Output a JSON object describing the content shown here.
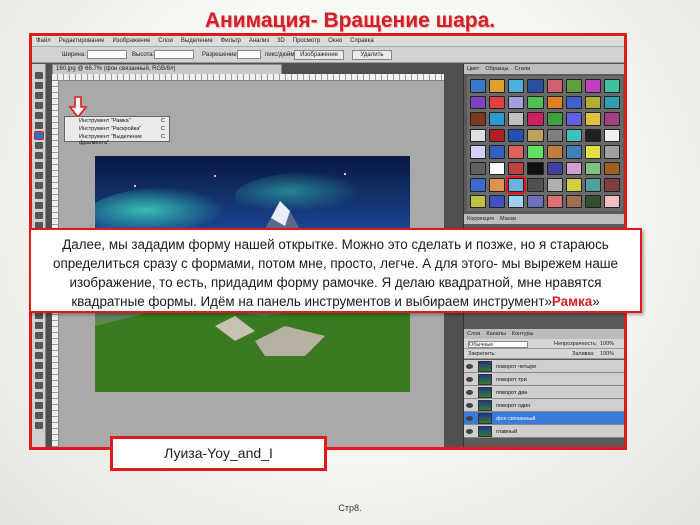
{
  "slide": {
    "title": "Анимация- Вращение шара.",
    "page_label": "Стр8."
  },
  "photoshop": {
    "menu": [
      "Файл",
      "Редактирование",
      "Изображение",
      "Слои",
      "Выделение",
      "Фильтр",
      "Анализ",
      "3D",
      "Просмотр",
      "Окно",
      "Справка"
    ],
    "options": {
      "width_label": "Ширина:",
      "height_label": "Высота:",
      "resolution_label": "Разрешение:",
      "resolution_unit": "пикс/дюйм",
      "image_button": "Изображение",
      "delete_button": "Удалить"
    },
    "document_tab": "160.jpg @ 66.7% (фон связанный, RGB/8#)",
    "tool_flyout": [
      {
        "label": "Инструмент \"Рамка\"",
        "key": "C"
      },
      {
        "label": "Инструмент \"Раскройка\"",
        "key": "C"
      },
      {
        "label": "Инструмент \"Выделение фрагмента\"",
        "key": "C"
      }
    ],
    "panel_tabs": [
      "Цвет",
      "Образцы",
      "Стили"
    ],
    "panel_tabs2": [
      "Коррекция",
      "Маски"
    ],
    "layers_tabs": [
      "Слои",
      "Каналы",
      "Контуры"
    ],
    "blend_mode": "Обычные",
    "opacity_label": "Непрозрачность:",
    "opacity_value": "100%",
    "lock_label": "Закрепить:",
    "fill_label": "Заливка:",
    "fill_value": "100%",
    "layers": [
      {
        "name": "поворот четыре",
        "selected": false
      },
      {
        "name": "поворот три",
        "selected": false
      },
      {
        "name": "поворот два",
        "selected": false
      },
      {
        "name": "поворот один",
        "selected": false
      },
      {
        "name": "фон связанный",
        "selected": true
      },
      {
        "name": "главный",
        "selected": false
      }
    ],
    "swatch_colors": [
      "#3a7ac8",
      "#e0a030",
      "#4ab0e0",
      "#2a50a0",
      "#d06070",
      "#60a040",
      "#c040c0",
      "#40c0a0",
      "#8040c0",
      "#e04040",
      "#a0a0e0",
      "#50c050",
      "#e08020",
      "#4060d0",
      "#b0b030",
      "#30a0b0",
      "#7a3a20",
      "#2a9ad0",
      "#c0c0c0",
      "#d02060",
      "#40a040",
      "#6060e0",
      "#e0c040",
      "#a04080",
      "#e0e0e0",
      "#b02020",
      "#2050b0",
      "#c0a060",
      "#808080",
      "#40c0c0",
      "#202020",
      "#f0f0f0",
      "#d0d0ff",
      "#3060c0",
      "#e06060",
      "#60e060",
      "#c08040",
      "#4080c0",
      "#e0e040",
      "#a0a0a0",
      "#606060",
      "#ffffff",
      "#c04040",
      "#101010",
      "#4040a0",
      "#d0a0d0",
      "#80c080",
      "#a06020",
      "#3a6ad0",
      "#e09050",
      "#70b0e0",
      "#505050",
      "#b0b0b0",
      "#d0d040",
      "#50a0a0",
      "#804040",
      "#c0c040",
      "#4050c0",
      "#a0d0f0",
      "#7070c0",
      "#e07070",
      "#a07050",
      "#305030",
      "#f0c0c0"
    ]
  },
  "instruction": {
    "text": "Далее, мы зададим форму нашей открытке. Можно это сделать и позже, но я стараюсь определиться сразу с формами, потом мне, просто, легче. А для этого- мы вырежем наше изображение, то есть, придадим форму рамочке. Я делаю квадратной, мне нравятся квадратные формы.  Идём на панель инструментов и выбираем  инструмент»",
    "highlight": "Рамка",
    "tail": "»"
  },
  "author": "Луиза-Yoy_and_I"
}
